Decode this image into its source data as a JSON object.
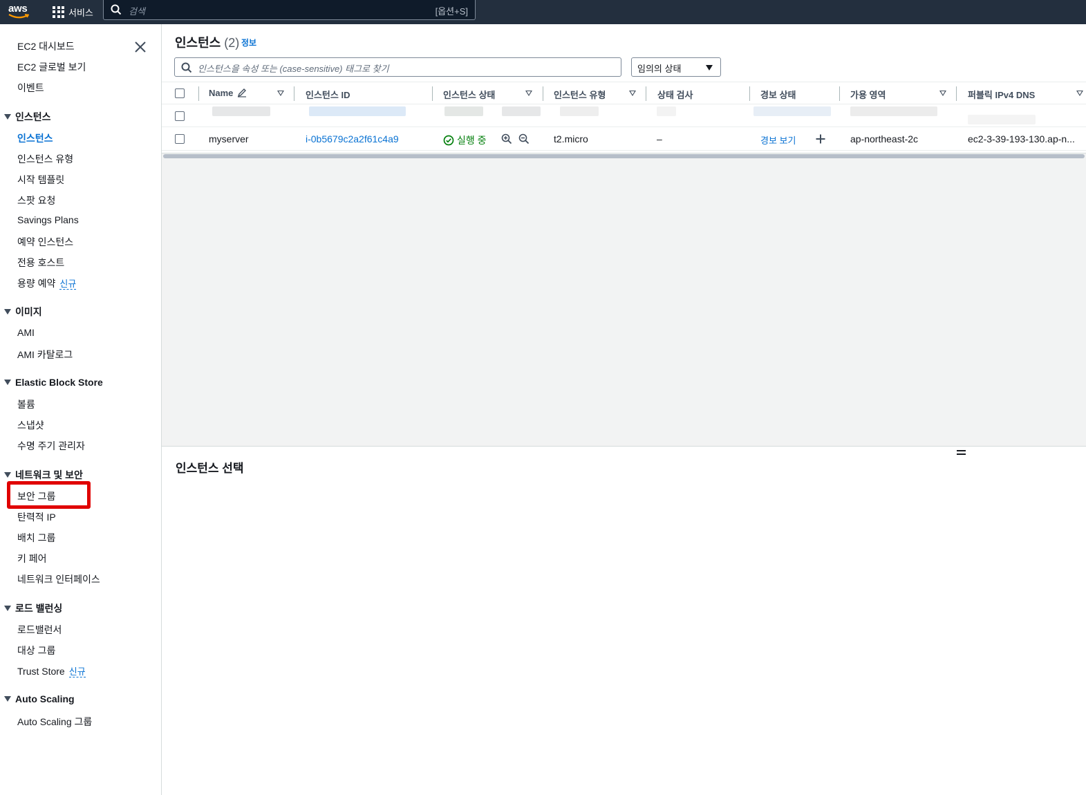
{
  "topnav": {
    "logo": "aws",
    "services_label": "서비스",
    "search_placeholder": "검색",
    "search_shortcut": "[옵션+S]"
  },
  "sidebar": {
    "top_items": [
      "EC2 대시보드",
      "EC2 글로벌 보기",
      "이벤트"
    ],
    "sections": [
      {
        "title": "인스턴스",
        "items": [
          "인스턴스",
          "인스턴스 유형",
          "시작 템플릿",
          "스팟 요청",
          "Savings Plans",
          "예약 인스턴스",
          "전용 호스트",
          "용량 예약"
        ]
      },
      {
        "title": "이미지",
        "items": [
          "AMI",
          "AMI 카탈로그"
        ]
      },
      {
        "title": "Elastic Block Store",
        "items": [
          "볼륨",
          "스냅샷",
          "수명 주기 관리자"
        ]
      },
      {
        "title": "네트워크 및 보안",
        "items": [
          "보안 그룹",
          "탄력적 IP",
          "배치 그룹",
          "키 페어",
          "네트워크 인터페이스"
        ]
      },
      {
        "title": "로드 밸런싱",
        "items": [
          "로드밸런서",
          "대상 그룹",
          "Trust Store"
        ]
      },
      {
        "title": "Auto Scaling",
        "items": [
          "Auto Scaling 그룹"
        ]
      }
    ],
    "new_badge": "신규",
    "active_item": "인스턴스",
    "highlighted_item": "보안 그룹",
    "highlight_color": "#e00000"
  },
  "main": {
    "title": "인스턴스",
    "count": "(2)",
    "info_label": "정보",
    "filter_placeholder": "인스턴스을 속성 또는 (case-sensitive) 태그로 찾기",
    "state_filter": "임의의 상태",
    "columns": [
      "Name",
      "인스턴스 ID",
      "인스턴스 상태",
      "인스턴스 유형",
      "상태 검사",
      "경보 상태",
      "가용 영역",
      "퍼블릭 IPv4 DNS"
    ],
    "rows": [
      {
        "name": "myserver",
        "instance_id": "i-0b5679c2a2f61c4a9",
        "state": "실행 중",
        "type": "t2.micro",
        "status_check": "–",
        "alarm": "경보 보기",
        "az": "ap-northeast-2c",
        "dns": "ec2-3-39-193-130.ap-n..."
      }
    ],
    "detail_title": "인스턴스 선택"
  },
  "colors": {
    "nav_bg": "#232f3e",
    "link": "#0972d3",
    "running": "#037f0c"
  }
}
